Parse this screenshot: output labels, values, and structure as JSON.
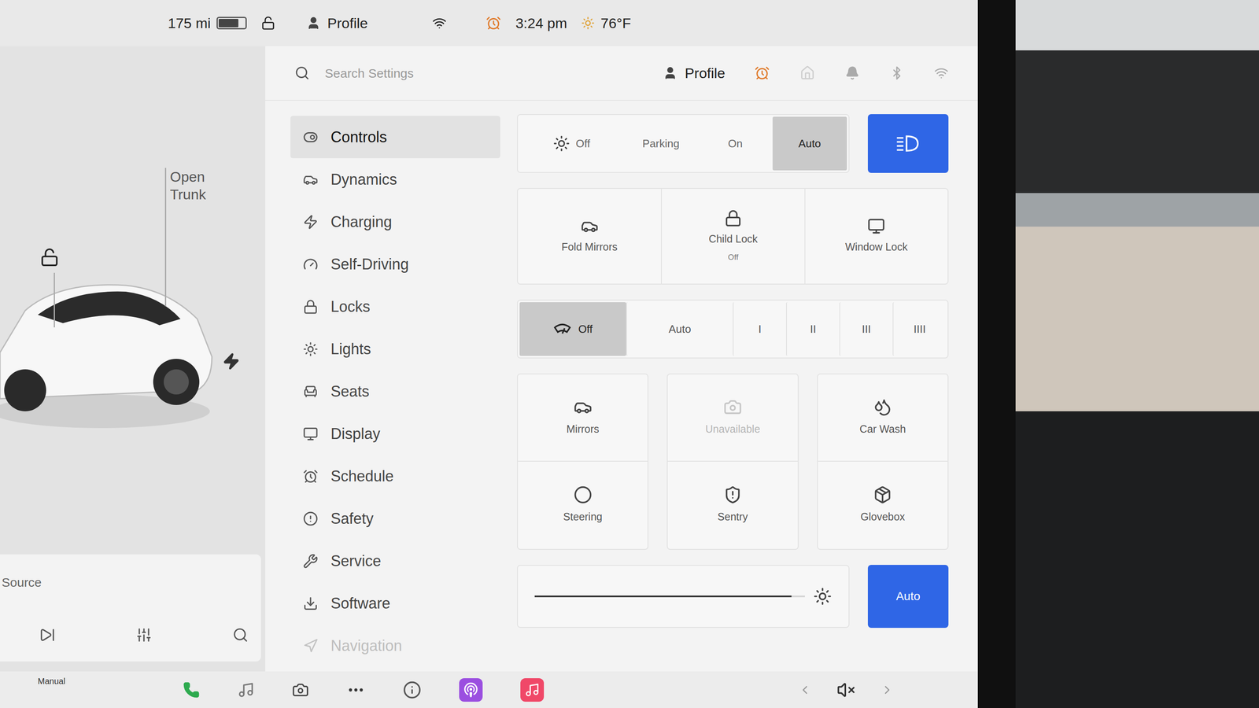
{
  "status_bar": {
    "range": "175 mi",
    "battery_level": 0.75,
    "locked": false,
    "profile": "Profile",
    "time": "3:24 pm",
    "temperature": "76°F"
  },
  "car_view": {
    "trunk_button": "Open Trunk",
    "doors_locked": false,
    "charge_port": true
  },
  "media": {
    "source": "Source"
  },
  "settings_header": {
    "search_placeholder": "Search Settings",
    "profile": "Profile"
  },
  "nav": [
    {
      "label": "Controls",
      "selected": true,
      "faded": false
    },
    {
      "label": "Dynamics",
      "selected": false,
      "faded": false
    },
    {
      "label": "Charging",
      "selected": false,
      "faded": false
    },
    {
      "label": "Self-Driving",
      "selected": false,
      "faded": false
    },
    {
      "label": "Locks",
      "selected": false,
      "faded": false
    },
    {
      "label": "Lights",
      "selected": false,
      "faded": false
    },
    {
      "label": "Seats",
      "selected": false,
      "faded": false
    },
    {
      "label": "Display",
      "selected": false,
      "faded": false
    },
    {
      "label": "Schedule",
      "selected": false,
      "faded": false
    },
    {
      "label": "Safety",
      "selected": false,
      "faded": false
    },
    {
      "label": "Service",
      "selected": false,
      "faded": false
    },
    {
      "label": "Software",
      "selected": false,
      "faded": false
    },
    {
      "label": "Navigation",
      "selected": false,
      "faded": true
    }
  ],
  "headlights": [
    {
      "label": "Off",
      "selected": false
    },
    {
      "label": "Parking",
      "selected": false
    },
    {
      "label": "On",
      "selected": false
    },
    {
      "label": "Auto",
      "selected": true
    }
  ],
  "auto_high_beam": {
    "on": true
  },
  "quick_tiles": [
    {
      "label": "Fold Mirrors"
    },
    {
      "label": "Child Lock",
      "status": "Off"
    },
    {
      "label": "Window Lock"
    }
  ],
  "wipers": [
    {
      "label": "Off",
      "selected": true
    },
    {
      "label": "Auto",
      "selected": false
    },
    {
      "label": "I",
      "selected": false
    },
    {
      "label": "II",
      "selected": false
    },
    {
      "label": "III",
      "selected": false
    },
    {
      "label": "IIII",
      "selected": false
    }
  ],
  "control_tiles": [
    {
      "label": "Mirrors",
      "disabled": false
    },
    {
      "label": "Unavailable",
      "disabled": true
    },
    {
      "label": "Car Wash",
      "disabled": false
    },
    {
      "label": "Steering",
      "disabled": false
    },
    {
      "label": "Sentry",
      "disabled": false
    },
    {
      "label": "Glovebox",
      "disabled": false
    }
  ],
  "display_brightness": {
    "level": 0.95,
    "auto": {
      "label": "Auto",
      "selected": true
    }
  },
  "taskbar": {
    "drive_label": "Manual",
    "muted": true
  }
}
